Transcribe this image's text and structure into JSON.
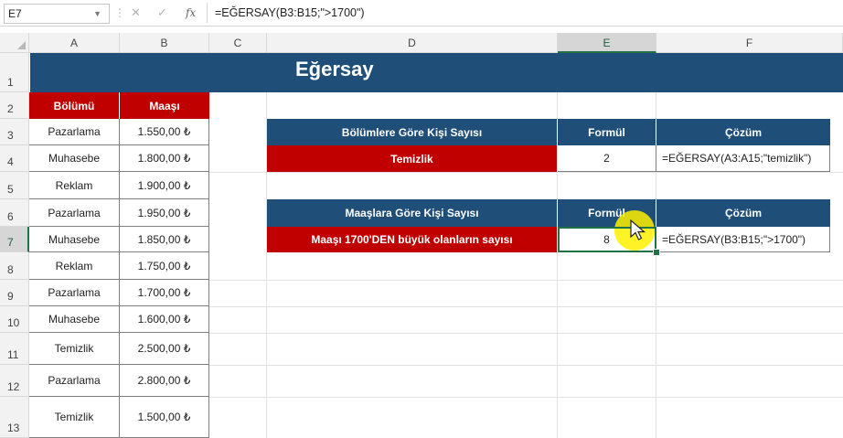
{
  "formula_bar": {
    "name_box": "E7",
    "cancel_icon": "✕",
    "enter_icon": "✓",
    "fx_label": "fx",
    "formula": "=EĞERSAY(B3:B15;\">1700\")"
  },
  "columns": [
    "A",
    "B",
    "C",
    "D",
    "E",
    "F"
  ],
  "rows": [
    "1",
    "2",
    "3",
    "4",
    "5",
    "6",
    "7",
    "8",
    "9",
    "10",
    "11",
    "12",
    "13"
  ],
  "title": "Eğersay",
  "left_table": {
    "headers": {
      "department": "Bölümü",
      "salary": "Maaşı"
    },
    "rows": [
      {
        "department": "Pazarlama",
        "salary": "1.550,00 ₺"
      },
      {
        "department": "Muhasebe",
        "salary": "1.800,00 ₺"
      },
      {
        "department": "Reklam",
        "salary": "1.900,00 ₺"
      },
      {
        "department": "Pazarlama",
        "salary": "1.950,00 ₺"
      },
      {
        "department": "Muhasebe",
        "salary": "1.850,00 ₺"
      },
      {
        "department": "Reklam",
        "salary": "1.750,00 ₺"
      },
      {
        "department": "Pazarlama",
        "salary": "1.700,00 ₺"
      },
      {
        "department": "Muhasebe",
        "salary": "1.600,00 ₺"
      },
      {
        "department": "Temizlik",
        "salary": "2.500,00 ₺"
      },
      {
        "department": "Pazarlama",
        "salary": "2.800,00 ₺"
      },
      {
        "department": "Temizlik",
        "salary": "1.500,00 ₺"
      }
    ]
  },
  "table1": {
    "header_label": "Bölümlere Göre Kişi Sayısı",
    "header_formula": "Formül",
    "header_solution": "Çözüm",
    "label": "Temizlik",
    "value": "2",
    "solution": "=EĞERSAY(A3:A15;\"temizlik\")"
  },
  "table2": {
    "header_label": "Maaşlara Göre Kişi Sayısı",
    "header_formula": "Formül",
    "header_solution": "Çözüm",
    "label": "Maaşı 1700'DEN büyük olanların sayısı",
    "value": "8",
    "solution": "=EĞERSAY(B3:B15;\">1700\")"
  },
  "colors": {
    "title_bg": "#1f4e79",
    "header_red": "#c00000",
    "selection_green": "#217346",
    "cursor_highlight": "#fff000"
  }
}
